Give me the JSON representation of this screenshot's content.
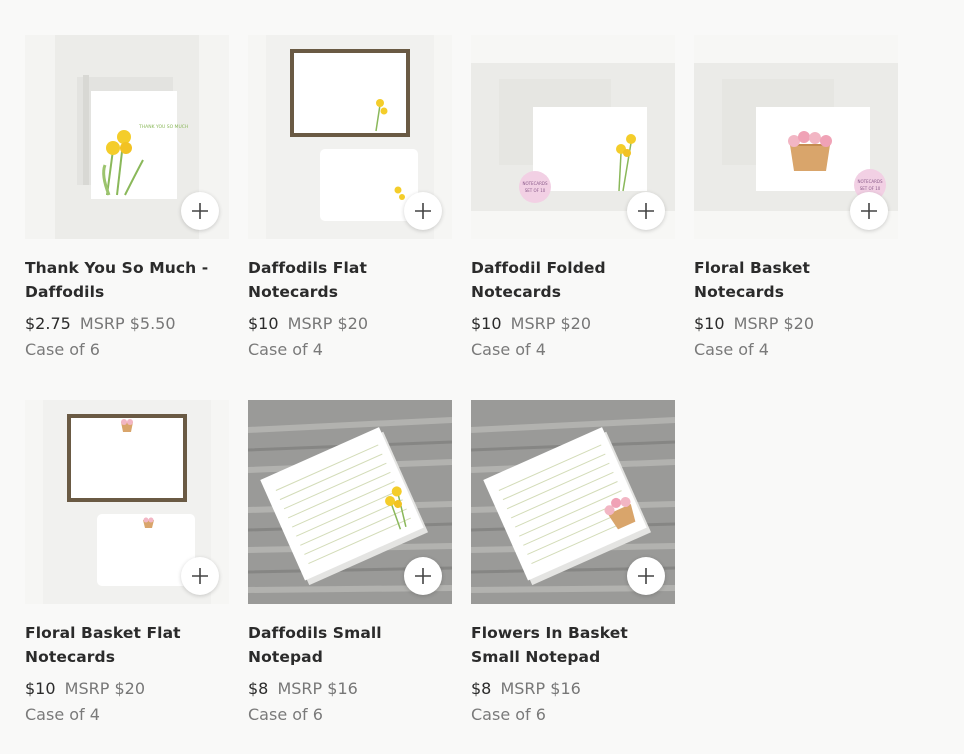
{
  "products": [
    {
      "title": "Thank You So Much - Daffodils",
      "price": "$2.75",
      "msrp": "MSRP $5.50",
      "case": "Case of 6",
      "card_text": "THANK YOU SO MUCH"
    },
    {
      "title": "Daffodils Flat Notecards",
      "price": "$10",
      "msrp": "MSRP $20",
      "case": "Case of 4"
    },
    {
      "title": "Daffodil Folded Notecards",
      "price": "$10",
      "msrp": "MSRP $20",
      "case": "Case of 4",
      "sticker_line1": "NOTECARDS",
      "sticker_line2": "SET OF 10"
    },
    {
      "title": "Floral Basket Notecards",
      "price": "$10",
      "msrp": "MSRP $20",
      "case": "Case of 4",
      "sticker_line1": "NOTECARDS",
      "sticker_line2": "SET OF 10"
    },
    {
      "title": "Floral Basket Flat Notecards",
      "price": "$10",
      "msrp": "MSRP $20",
      "case": "Case of 4"
    },
    {
      "title": "Daffodils Small Notepad",
      "price": "$8",
      "msrp": "MSRP $16",
      "case": "Case of 6"
    },
    {
      "title": "Flowers In Basket Small Notepad",
      "price": "$8",
      "msrp": "MSRP $16",
      "case": "Case of 6"
    }
  ],
  "icons": {
    "add": "plus-icon"
  },
  "colors": {
    "daffodil": "#f4cd2a",
    "stem": "#8ab85a",
    "pink": "#f2b6c4",
    "basket": "#d9a56b",
    "wood": "#9a9a98"
  }
}
